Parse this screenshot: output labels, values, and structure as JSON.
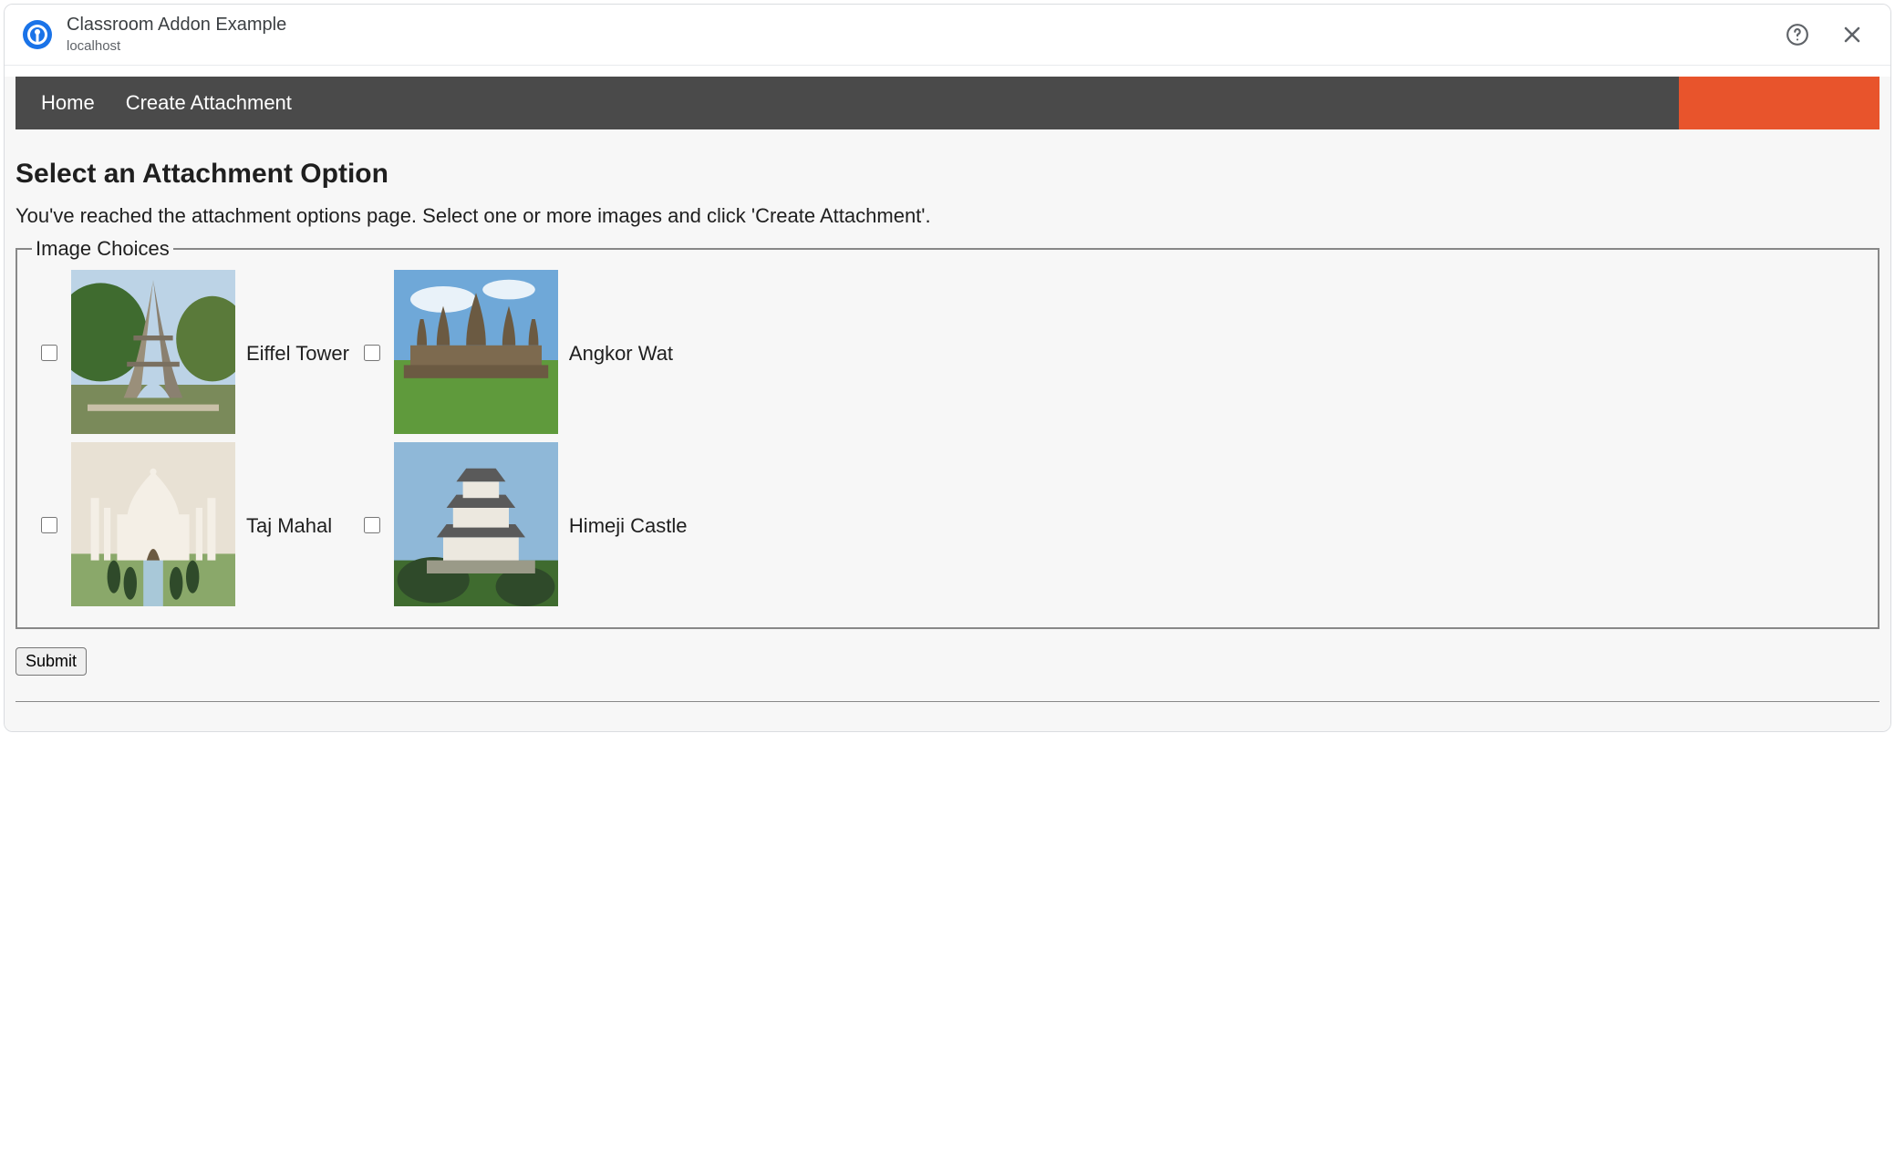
{
  "titlebar": {
    "title": "Classroom Addon Example",
    "subtitle": "localhost"
  },
  "nav": {
    "home": "Home",
    "create": "Create Attachment"
  },
  "page": {
    "heading": "Select an Attachment Option",
    "instruction": "You've reached the attachment options page. Select one or more images and click 'Create Attachment'.",
    "legend": "Image Choices",
    "submit": "Submit"
  },
  "choices": [
    {
      "label": "Eiffel Tower"
    },
    {
      "label": "Angkor Wat"
    },
    {
      "label": "Taj Mahal"
    },
    {
      "label": "Himeji Castle"
    }
  ]
}
